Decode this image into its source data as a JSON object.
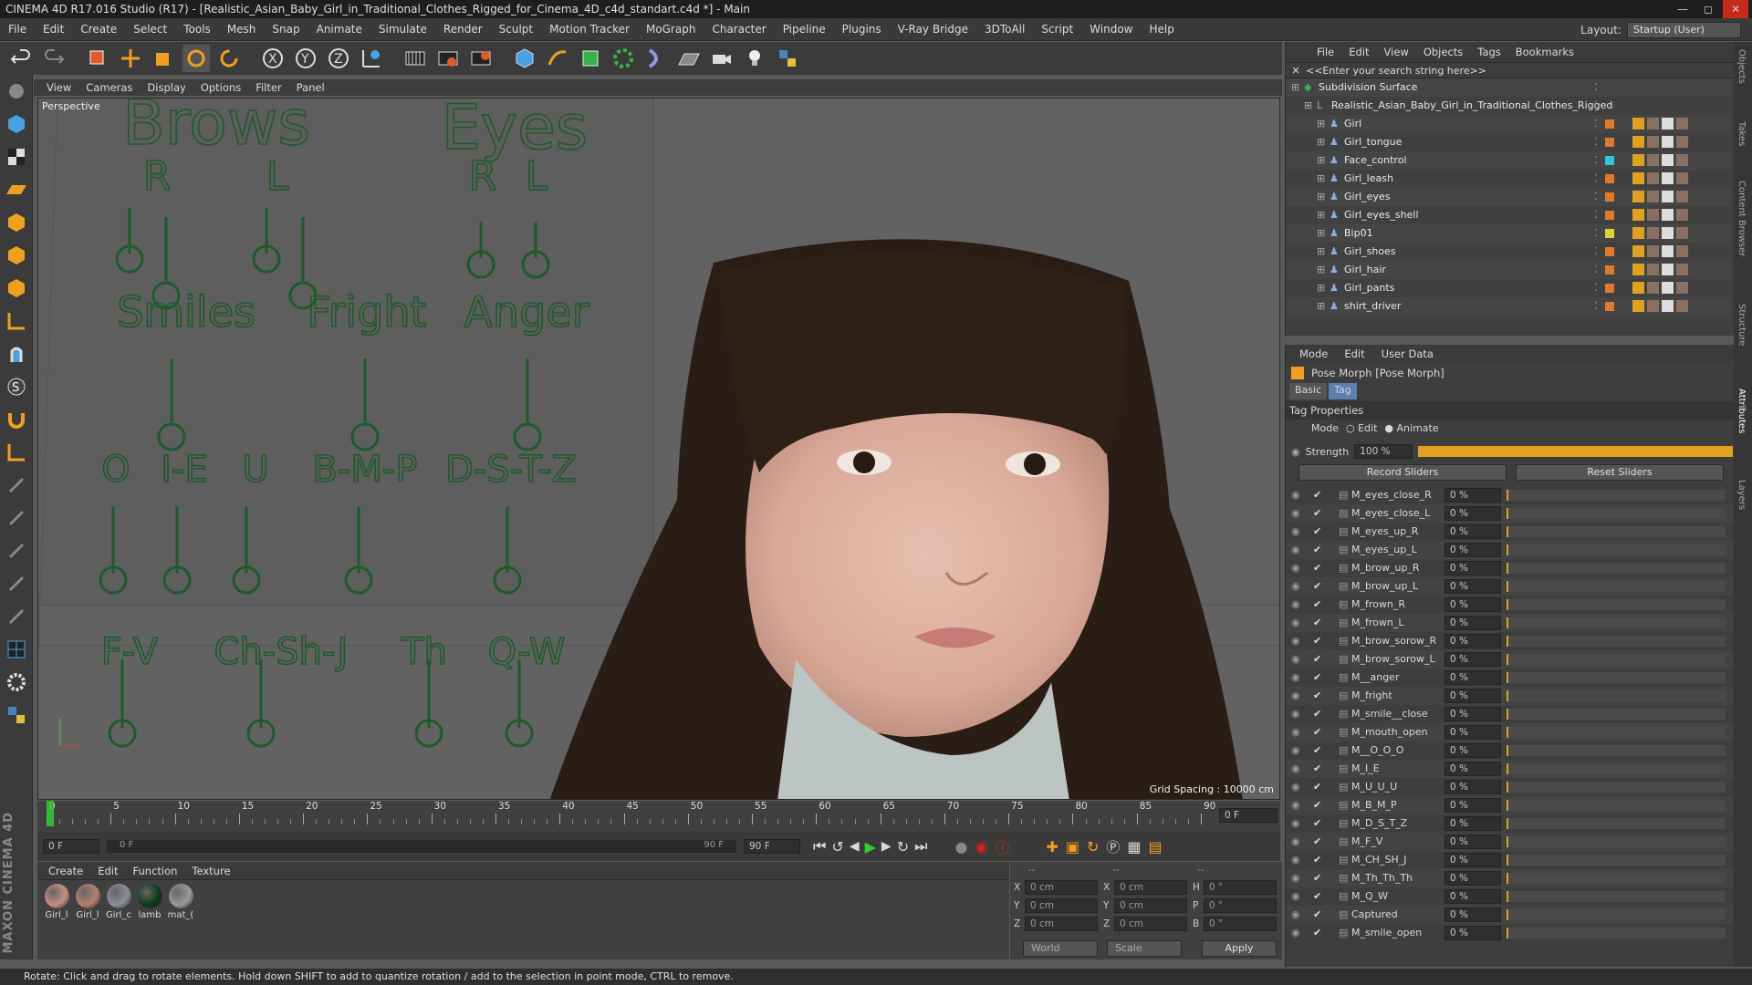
{
  "window": {
    "title": "CINEMA 4D R17.016 Studio (R17) - [Realistic_Asian_Baby_Girl_in_Traditional_Clothes_Rigged_for_Cinema_4D_c4d_standart.c4d *] - Main"
  },
  "menu": [
    "File",
    "Edit",
    "Create",
    "Select",
    "Tools",
    "Mesh",
    "Snap",
    "Animate",
    "Simulate",
    "Render",
    "Sculpt",
    "Motion Tracker",
    "MoGraph",
    "Character",
    "Pipeline",
    "Plugins",
    "V-Ray Bridge",
    "3DToAll",
    "Script",
    "Window",
    "Help"
  ],
  "layout": {
    "label": "Layout:",
    "value": "Startup (User)"
  },
  "viewport": {
    "menu": [
      "View",
      "Cameras",
      "Display",
      "Options",
      "Filter",
      "Panel"
    ],
    "label": "Perspective",
    "grid_spacing": "Grid Spacing : 10000 cm",
    "rig_labels": {
      "brows": "Brows",
      "eyes": "Eyes",
      "brow_r": "R",
      "brow_l": "L",
      "eye_r": "R",
      "eye_l": "L",
      "smiles": "Smiles",
      "fright": "Fright",
      "anger": "Anger",
      "o": "O",
      "ie": "I-E",
      "u": "U",
      "bmp": "B-M-P",
      "dstz": "D-S-T-Z",
      "fv": "F-V",
      "chshj": "Ch-Sh-J",
      "th": "Th",
      "qw": "Q-W"
    }
  },
  "timeline": {
    "ticks": [
      "0",
      "5",
      "10",
      "15",
      "20",
      "25",
      "30",
      "35",
      "40",
      "45",
      "50",
      "55",
      "60",
      "65",
      "70",
      "75",
      "80",
      "85",
      "90"
    ],
    "current_frame": "0 F",
    "start": "0 F",
    "range_start": "0 F",
    "range_end": "90 F",
    "end": "90 F"
  },
  "materials": {
    "menu": [
      "Create",
      "Edit",
      "Function",
      "Texture"
    ],
    "items": [
      {
        "name": "Girl_l",
        "color": "#c78f80"
      },
      {
        "name": "Girl_l",
        "color": "#b98070"
      },
      {
        "name": "Girl_c",
        "color": "#8b8f99"
      },
      {
        "name": "lamb",
        "color": "#0d3a1a"
      },
      {
        "name": "mat_(",
        "color": "#9a9a9a"
      }
    ]
  },
  "coords": {
    "headers": [
      "--",
      "--",
      "--"
    ],
    "rows": [
      {
        "a": "X",
        "av": "0 cm",
        "b": "X",
        "bv": "0 cm",
        "c": "H",
        "cv": "0 °"
      },
      {
        "a": "Y",
        "av": "0 cm",
        "b": "Y",
        "bv": "0 cm",
        "c": "P",
        "cv": "0 °"
      },
      {
        "a": "Z",
        "av": "0 cm",
        "b": "Z",
        "bv": "0 cm",
        "c": "B",
        "cv": "0 °"
      }
    ],
    "space": "World",
    "mode": "Scale",
    "apply": "Apply"
  },
  "status": "Rotate: Click and drag to rotate elements. Hold down SHIFT to add to quantize rotation / add to the selection in point mode, CTRL to remove.",
  "objects": {
    "menu": [
      "File",
      "Edit",
      "View",
      "Objects",
      "Tags",
      "Bookmarks"
    ],
    "search_placeholder": "<<Enter your search string here>>",
    "items": [
      {
        "name": "Subdivision Surface",
        "indent": 0,
        "color": ""
      },
      {
        "name": "Realistic_Asian_Baby_Girl_in_Traditional_Clothes_Rigged",
        "indent": 1,
        "color": ""
      },
      {
        "name": "Girl",
        "indent": 2,
        "color": "#e07a2a"
      },
      {
        "name": "Girl_tongue",
        "indent": 2,
        "color": "#e07a2a"
      },
      {
        "name": "Face_control",
        "indent": 2,
        "color": "#30c8d8"
      },
      {
        "name": "Girl_leash",
        "indent": 2,
        "color": "#e07a2a"
      },
      {
        "name": "Girl_eyes",
        "indent": 2,
        "color": "#e07a2a"
      },
      {
        "name": "Girl_eyes_shell",
        "indent": 2,
        "color": "#e07a2a"
      },
      {
        "name": "Bip01",
        "indent": 2,
        "color": "#d8d830"
      },
      {
        "name": "Girl_shoes",
        "indent": 2,
        "color": "#e07a2a"
      },
      {
        "name": "Girl_hair",
        "indent": 2,
        "color": "#e07a2a"
      },
      {
        "name": "Girl_pants",
        "indent": 2,
        "color": "#e07a2a"
      },
      {
        "name": "shirt_driver",
        "indent": 2,
        "color": "#e07a2a"
      }
    ]
  },
  "attributes": {
    "menu": [
      "Mode",
      "Edit",
      "User Data"
    ],
    "title": "Pose Morph [Pose Morph]",
    "tabs": [
      "Basic",
      "Tag"
    ],
    "section": "Tag Properties",
    "mode_label": "Mode",
    "mode_edit": "Edit",
    "mode_animate": "Animate",
    "strength_label": "Strength",
    "strength_value": "100 %",
    "strength_fraction": 1.0,
    "record": "Record Sliders",
    "reset": "Reset Sliders",
    "morphs": [
      {
        "name": "M_eyes_close_R",
        "value": "0 %"
      },
      {
        "name": "M_eyes_close_L",
        "value": "0 %"
      },
      {
        "name": "M_eyes_up_R",
        "value": "0 %"
      },
      {
        "name": "M_eyes_up_L",
        "value": "0 %"
      },
      {
        "name": "M_brow_up_R",
        "value": "0 %"
      },
      {
        "name": "M_brow_up_L",
        "value": "0 %"
      },
      {
        "name": "M_frown_R",
        "value": "0 %"
      },
      {
        "name": "M_frown_L",
        "value": "0 %"
      },
      {
        "name": "M_brow_sorow_R",
        "value": "0 %"
      },
      {
        "name": "M_brow_sorow_L",
        "value": "0 %"
      },
      {
        "name": "M__anger",
        "value": "0 %"
      },
      {
        "name": "M_fright",
        "value": "0 %"
      },
      {
        "name": "M_smile__close",
        "value": "0 %"
      },
      {
        "name": "M_mouth_open",
        "value": "0 %"
      },
      {
        "name": "M__O_O_O",
        "value": "0 %"
      },
      {
        "name": "M_I_E",
        "value": "0 %"
      },
      {
        "name": "M_U_U_U",
        "value": "0 %"
      },
      {
        "name": "M_B_M_P",
        "value": "0 %"
      },
      {
        "name": "M_D_S_T_Z",
        "value": "0 %"
      },
      {
        "name": "M_F_V",
        "value": "0 %"
      },
      {
        "name": "M_CH_SH_J",
        "value": "0 %"
      },
      {
        "name": "M_Th_Th_Th",
        "value": "0 %"
      },
      {
        "name": "M_Q_W",
        "value": "0 %"
      },
      {
        "name": "Captured",
        "value": "0 %"
      },
      {
        "name": "M_smile_open",
        "value": "0 %"
      }
    ]
  },
  "side_tabs": [
    "Objects",
    "Takes",
    "Content Browser",
    "Structure",
    "Attributes",
    "Layers"
  ]
}
